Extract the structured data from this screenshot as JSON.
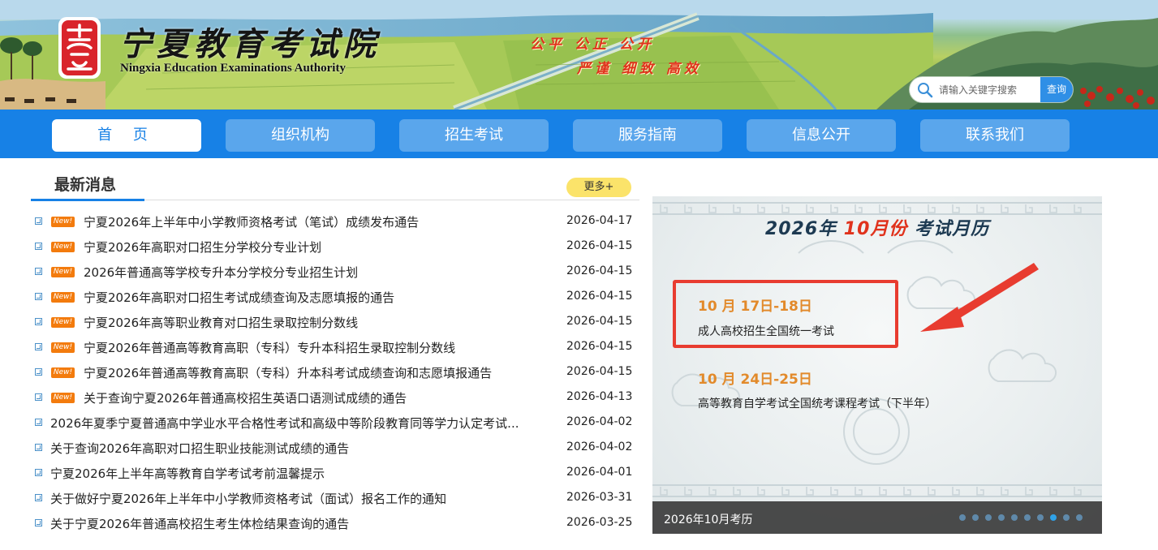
{
  "header": {
    "logo_cn": "宁夏教育考试院",
    "logo_en": "Ningxia Education Examinations Authority",
    "slogan_line1": "公平 公正 公开",
    "slogan_line2": "严谨 细致 高效",
    "search": {
      "placeholder": "请输入关键字搜索",
      "button": "查询"
    }
  },
  "nav": {
    "items": [
      {
        "label": "首 页",
        "active": true
      },
      {
        "label": "组织机构",
        "active": false
      },
      {
        "label": "招生考试",
        "active": false
      },
      {
        "label": "服务指南",
        "active": false
      },
      {
        "label": "信息公开",
        "active": false
      },
      {
        "label": "联系我们",
        "active": false
      }
    ]
  },
  "news": {
    "title": "最新消息",
    "more": "更多+",
    "new_badge": "New!",
    "items": [
      {
        "title": "宁夏2026年上半年中小学教师资格考试（笔试）成绩发布通告",
        "date": "2026-04-17",
        "is_new": true
      },
      {
        "title": "宁夏2026年高职对口招生分学校分专业计划",
        "date": "2026-04-15",
        "is_new": true
      },
      {
        "title": "2026年普通高等学校专升本分学校分专业招生计划",
        "date": "2026-04-15",
        "is_new": true
      },
      {
        "title": "宁夏2026年高职对口招生考试成绩查询及志愿填报的通告",
        "date": "2026-04-15",
        "is_new": true
      },
      {
        "title": "宁夏2026年高等职业教育对口招生录取控制分数线",
        "date": "2026-04-15",
        "is_new": true
      },
      {
        "title": "宁夏2026年普通高等教育高职（专科）专升本科招生录取控制分数线",
        "date": "2026-04-15",
        "is_new": true
      },
      {
        "title": "宁夏2026年普通高等教育高职（专科）升本科考试成绩查询和志愿填报通告",
        "date": "2026-04-15",
        "is_new": true
      },
      {
        "title": "关于查询宁夏2026年普通高校招生英语口语测试成绩的通告",
        "date": "2026-04-13",
        "is_new": true
      },
      {
        "title": "2026年夏季宁夏普通高中学业水平合格性考试和高级中等阶段教育同等学力认定考试...",
        "date": "2026-04-02",
        "is_new": false
      },
      {
        "title": "关于查询2026年高职对口招生职业技能测试成绩的通告",
        "date": "2026-04-02",
        "is_new": false
      },
      {
        "title": "宁夏2026年上半年高等教育自学考试考前温馨提示",
        "date": "2026-04-01",
        "is_new": false
      },
      {
        "title": "关于做好宁夏2026年上半年中小学教师资格考试（面试）报名工作的通知",
        "date": "2026-03-31",
        "is_new": false
      },
      {
        "title": "关于宁夏2026年普通高校招生考生体检结果查询的通告",
        "date": "2026-03-25",
        "is_new": false
      }
    ]
  },
  "slider": {
    "title_part1": "2026年",
    "title_highlight": "10月份",
    "title_part2": "考试月历",
    "events": [
      {
        "date": "10 月 17日-18日",
        "name": "成人高校招生全国统一考试"
      },
      {
        "date": "10 月 24日-25日",
        "name": "高等教育自学考试全国统考课程考试（下半年）"
      }
    ],
    "caption": "2026年10月考历",
    "dots_total": 10,
    "active_dot": 8
  },
  "colors": {
    "nav_bg": "#1781e6",
    "nav_item_bg": "#5aa6ec",
    "accent_red": "#e0321c",
    "new_badge": "#f37b0d",
    "more_button": "#fbe36a",
    "event_date": "#e28a2b",
    "highlight_box": "#e83c30"
  }
}
